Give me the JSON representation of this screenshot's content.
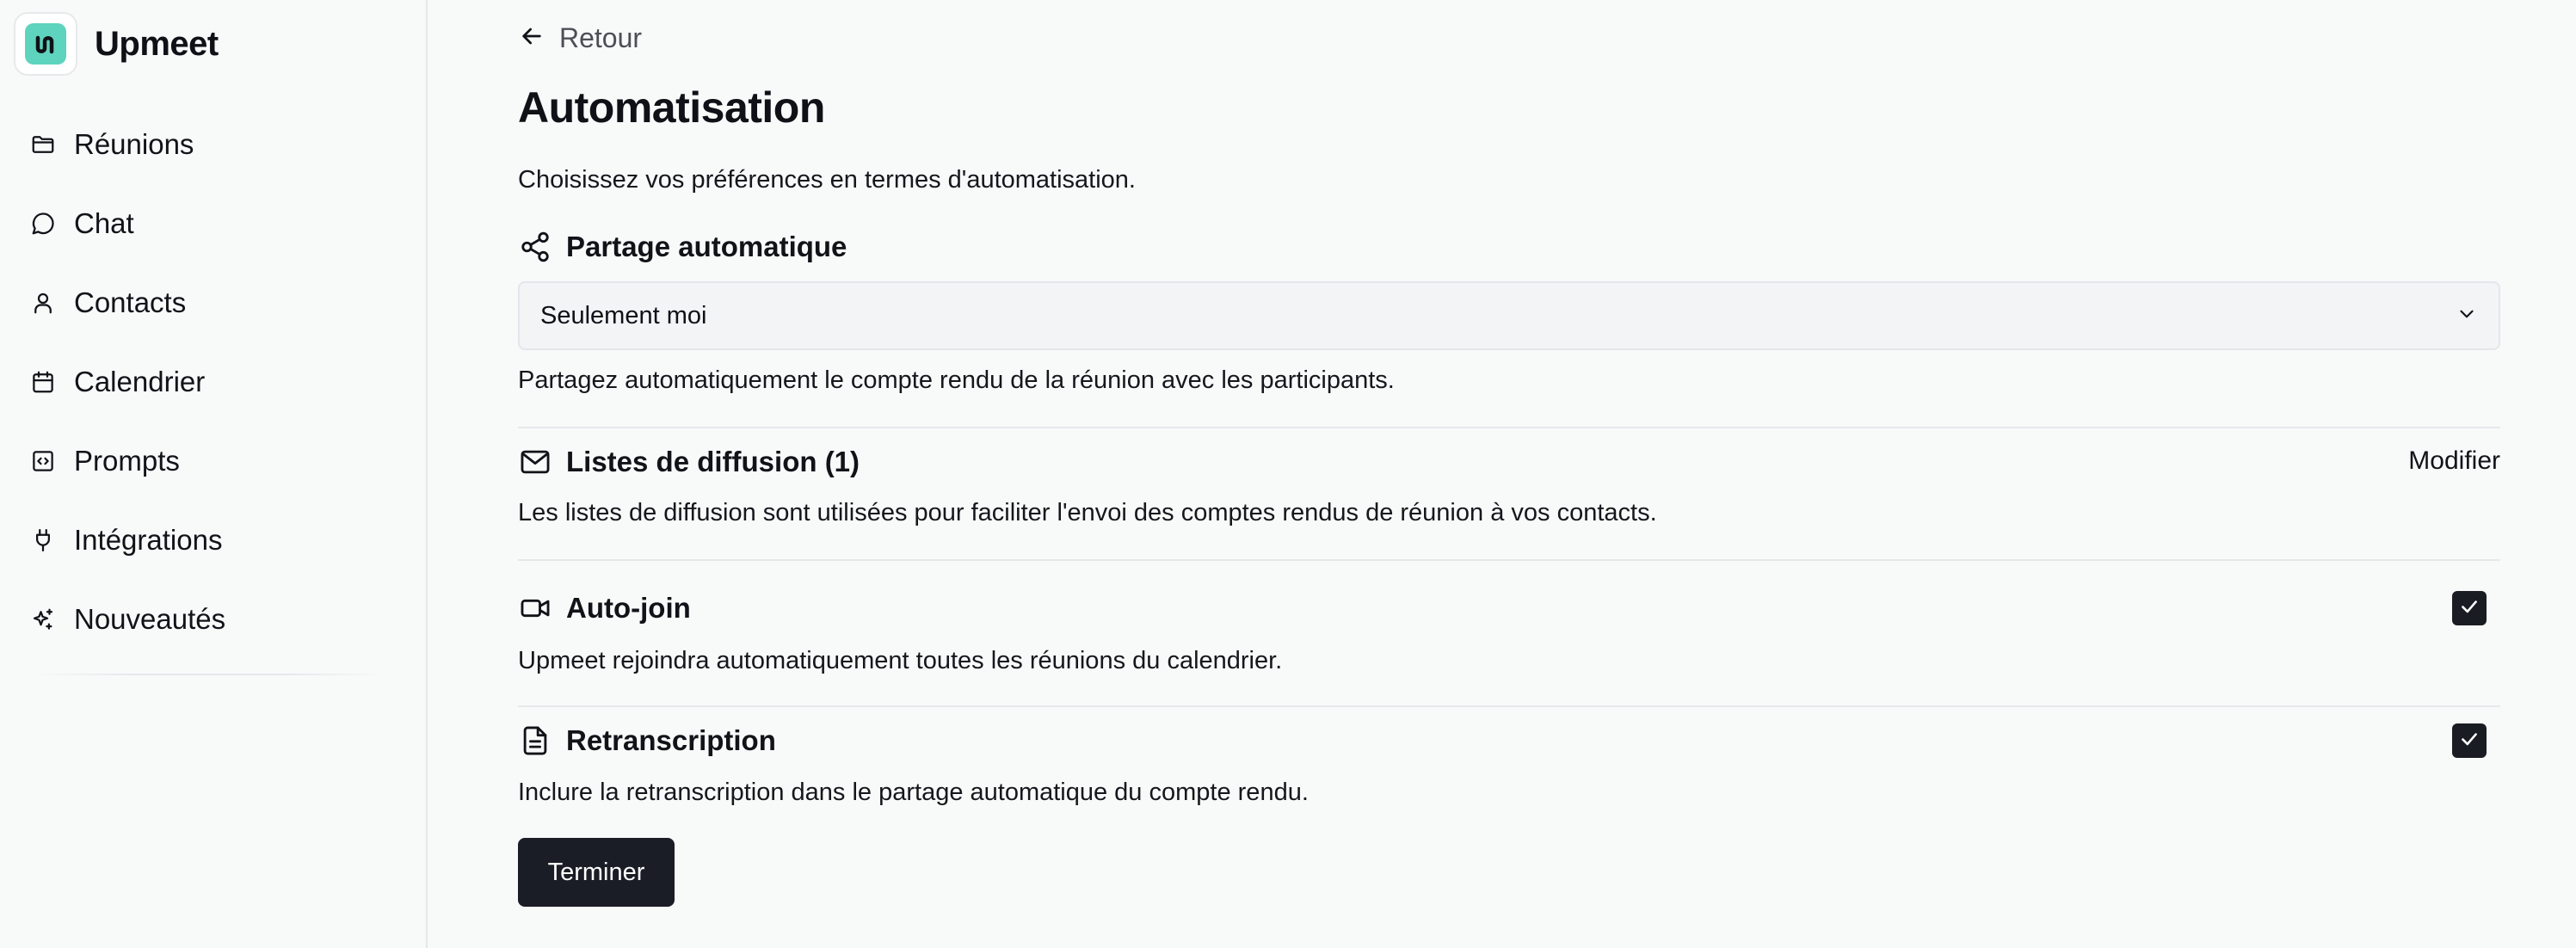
{
  "brand": {
    "name": "Upmeet",
    "logo_icon": "upmeet-logo-icon",
    "accent": "#5ed3bd"
  },
  "sidebar": {
    "items": [
      {
        "label": "Réunions",
        "icon": "folder-icon"
      },
      {
        "label": "Chat",
        "icon": "chat-bubble-icon"
      },
      {
        "label": "Contacts",
        "icon": "user-icon"
      },
      {
        "label": "Calendrier",
        "icon": "calendar-icon"
      },
      {
        "label": "Prompts",
        "icon": "code-square-icon"
      },
      {
        "label": "Intégrations",
        "icon": "plug-icon"
      },
      {
        "label": "Nouveautés",
        "icon": "sparkles-icon"
      }
    ]
  },
  "header": {
    "back_label": "Retour",
    "title": "Automatisation",
    "description": "Choisissez vos préférences en termes d'automatisation."
  },
  "sections": {
    "sharing": {
      "title": "Partage automatique",
      "icon": "share-icon",
      "select_value": "Seulement moi",
      "description": "Partagez automatiquement le compte rendu de la réunion avec les participants."
    },
    "mailing_lists": {
      "title": "Listes de diffusion (1)",
      "icon": "mail-icon",
      "action_label": "Modifier",
      "description": "Les listes de diffusion sont utilisées pour faciliter l'envoi des comptes rendus de réunion à vos contacts."
    },
    "auto_join": {
      "title": "Auto-join",
      "icon": "video-camera-icon",
      "checked": true,
      "description": "Upmeet rejoindra automatiquement toutes les réunions du calendrier."
    },
    "transcription": {
      "title": "Retranscription",
      "icon": "document-icon",
      "checked": true,
      "description": "Inclure la retranscription dans le partage automatique du compte rendu."
    }
  },
  "footer": {
    "finish_label": "Terminer"
  }
}
